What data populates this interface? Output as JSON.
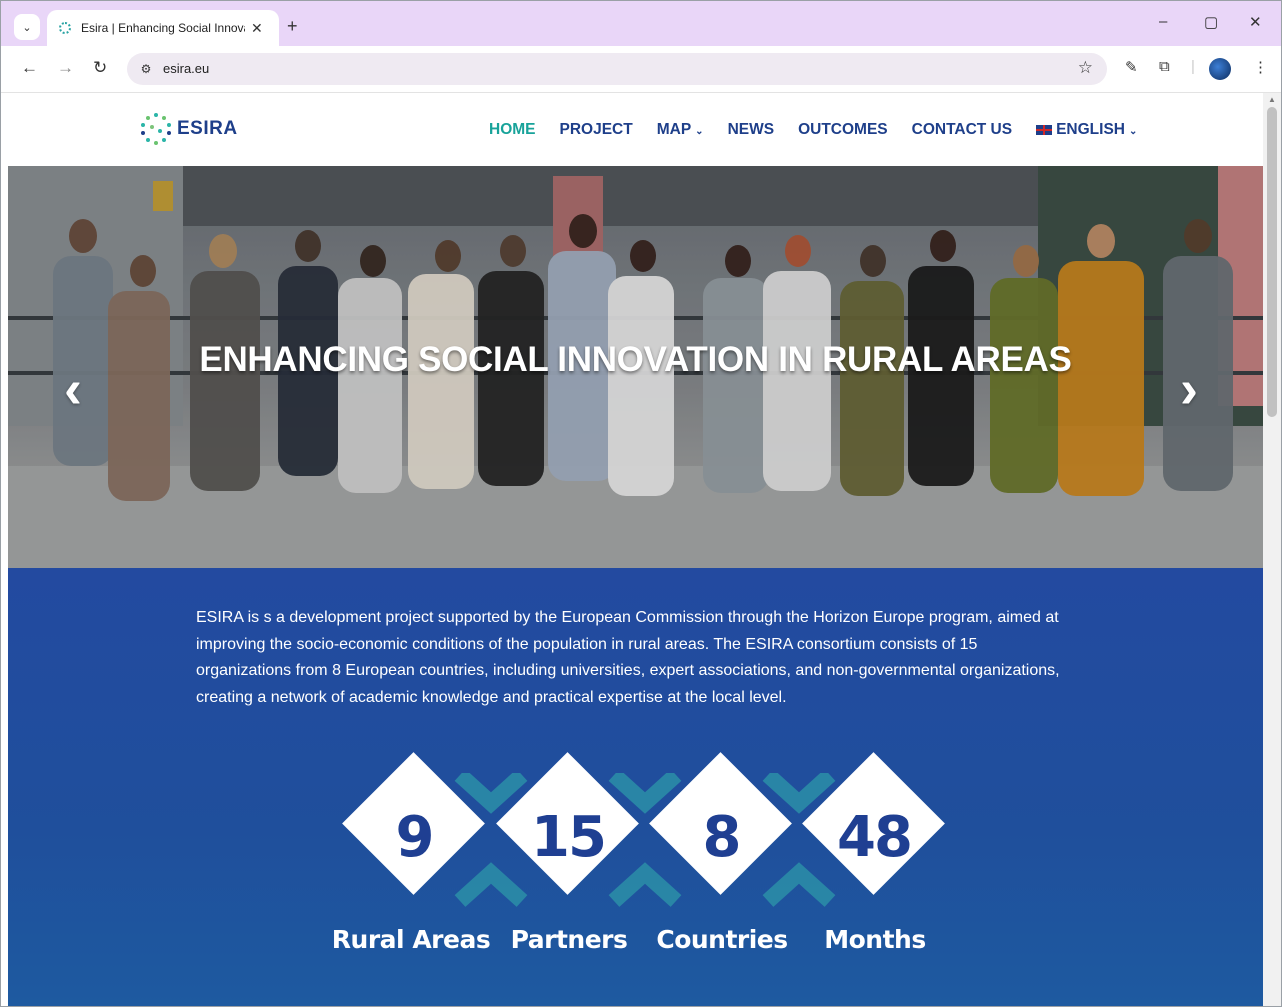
{
  "browser": {
    "tab_title": "Esira | Enhancing Social Innovat",
    "tab_close": "✕",
    "new_tab": "+",
    "url": "esira.eu",
    "window_controls": {
      "minimize": "–",
      "maximize": "▢",
      "close": "✕"
    },
    "icons": {
      "tab_search": "chevron-down-icon",
      "back": "back-arrow-icon",
      "forward": "forward-arrow-icon",
      "reload": "reload-icon",
      "site_info": "site-settings-icon",
      "bookmark": "star-icon",
      "extension1": "pen-icon",
      "extensions": "puzzle-icon",
      "menu": "kebab-menu-icon"
    }
  },
  "site": {
    "logo_text": "ESIRA",
    "nav": [
      {
        "label": "HOME",
        "active": true
      },
      {
        "label": "PROJECT"
      },
      {
        "label": "MAP",
        "has_dropdown": true
      },
      {
        "label": "NEWS"
      },
      {
        "label": "OUTCOMES"
      },
      {
        "label": "CONTACT US"
      },
      {
        "label": "ENGLISH",
        "has_dropdown": true,
        "flag": "uk-flag-icon"
      }
    ],
    "colors": {
      "nav_text": "#1e3f8a",
      "nav_active": "#18a39a",
      "section_bg": "#234aa0"
    }
  },
  "hero": {
    "title": "ENHANCING SOCIAL INNOVATION IN RURAL AREAS",
    "prev_arrow": "‹",
    "next_arrow": "›"
  },
  "intro": {
    "text": "ESIRA is s a development project supported by the European Commission through the Horizon Europe program, aimed at improving the socio-economic conditions of the population in rural areas. The ESIRA consortium consists of 15 organizations from 8 European countries, including universities, expert associations, and non-governmental organizations, creating a network of academic knowledge and practical expertise at the local level."
  },
  "stats": [
    {
      "value": "9",
      "label": "Rural Areas"
    },
    {
      "value": "15",
      "label": "Partners"
    },
    {
      "value": "8",
      "label": "Countries"
    },
    {
      "value": "48",
      "label": "Months"
    }
  ]
}
